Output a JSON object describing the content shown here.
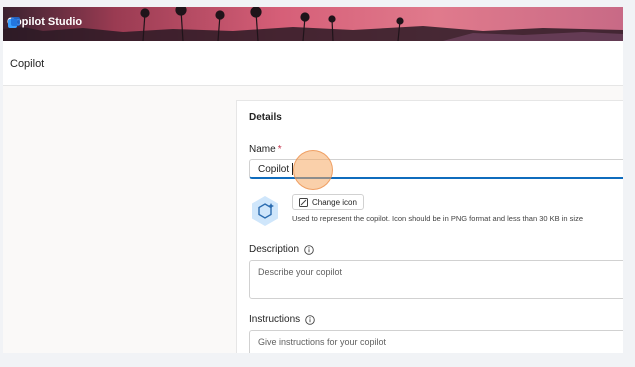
{
  "app": {
    "title": "Copilot Studio"
  },
  "header": {
    "breadcrumb": "Copilot"
  },
  "details": {
    "section_title": "Details",
    "name": {
      "label": "Name",
      "required_mark": "*",
      "value": "Copilot"
    },
    "icon": {
      "change_button_label": "Change icon",
      "hint": "Used to represent the copilot. Icon should be in PNG format and less than 30 KB in size"
    },
    "description": {
      "label": "Description",
      "placeholder": "Describe your copilot"
    },
    "instructions": {
      "label": "Instructions",
      "placeholder": "Give instructions for your copilot"
    }
  },
  "colors": {
    "accent": "#0f6cbd",
    "required": "#c4314b",
    "banner_pink": "#d65f78"
  },
  "icons": [
    "copilot-studio-logo-icon",
    "change-icon-icon",
    "copilot-hexagon-icon",
    "info-icon"
  ]
}
